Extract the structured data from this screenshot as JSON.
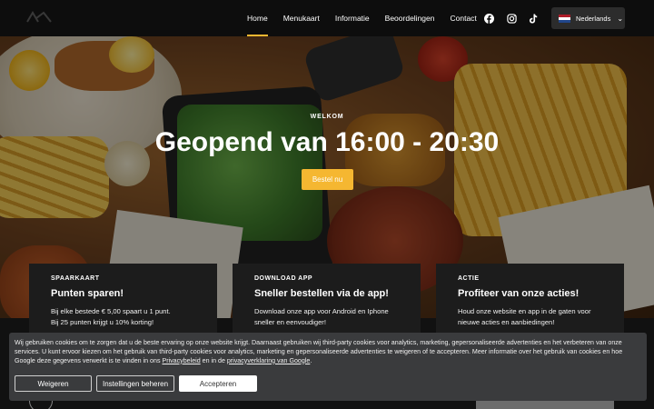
{
  "header": {
    "nav": [
      "Home",
      "Menukaart",
      "Informatie",
      "Beoordelingen",
      "Contact"
    ],
    "active_index": 0,
    "social_icons": [
      "facebook-icon",
      "instagram-icon",
      "tiktok-icon"
    ],
    "language": "Nederlands"
  },
  "hero": {
    "eyebrow": "WELKOM",
    "headline": "Geopend van 16:00 - 20:30",
    "cta": "Bestel nu"
  },
  "cards": [
    {
      "label": "SPAARKAART",
      "title": "Punten sparen!",
      "line1": "Bij elke bestede € 5,00 spaart u 1 punt.",
      "line2": "Bij 25 punten krijgt u 10% korting!"
    },
    {
      "label": "DOWNLOAD APP",
      "title": "Sneller bestellen via de app!",
      "line1": "Download onze app voor Android en Iphone",
      "line2": "sneller en eenvoudiger!"
    },
    {
      "label": "ACTIE",
      "title": "Profiteer van onze acties!",
      "line1": "Houd onze website en app in de gaten voor",
      "line2": "nieuwe acties en aanbiedingen!"
    }
  ],
  "cookie": {
    "text_before": "Wij gebruiken cookies om te zorgen dat u de beste ervaring op onze website krijgt. Daarnaast gebruiken wij third-party cookies voor analytics, marketing, gepersonaliseerde advertenties en het verbeteren van onze services. U kunt ervoor kiezen om het gebruik van third-party cookies voor analytics, marketing en gepersonaliseerde advertenties te weigeren of te accepteren. Meer informatie over het gebruik van cookies en hoe Google deze gegevens verwerkt is te vinden in ons ",
    "link1": "Privacybeleid",
    "text_mid": " en in de ",
    "link2": "privacyverklaring van Google",
    "text_end": ".",
    "buttons": {
      "reject": "Weigeren",
      "settings": "Instellingen beheren",
      "accept": "Accepteren"
    }
  },
  "colors": {
    "accent": "#f5b731",
    "topbar": "#0d0d0d",
    "card_bg": "#1c1c1c",
    "cookie_bg": "#3a3b3d"
  }
}
